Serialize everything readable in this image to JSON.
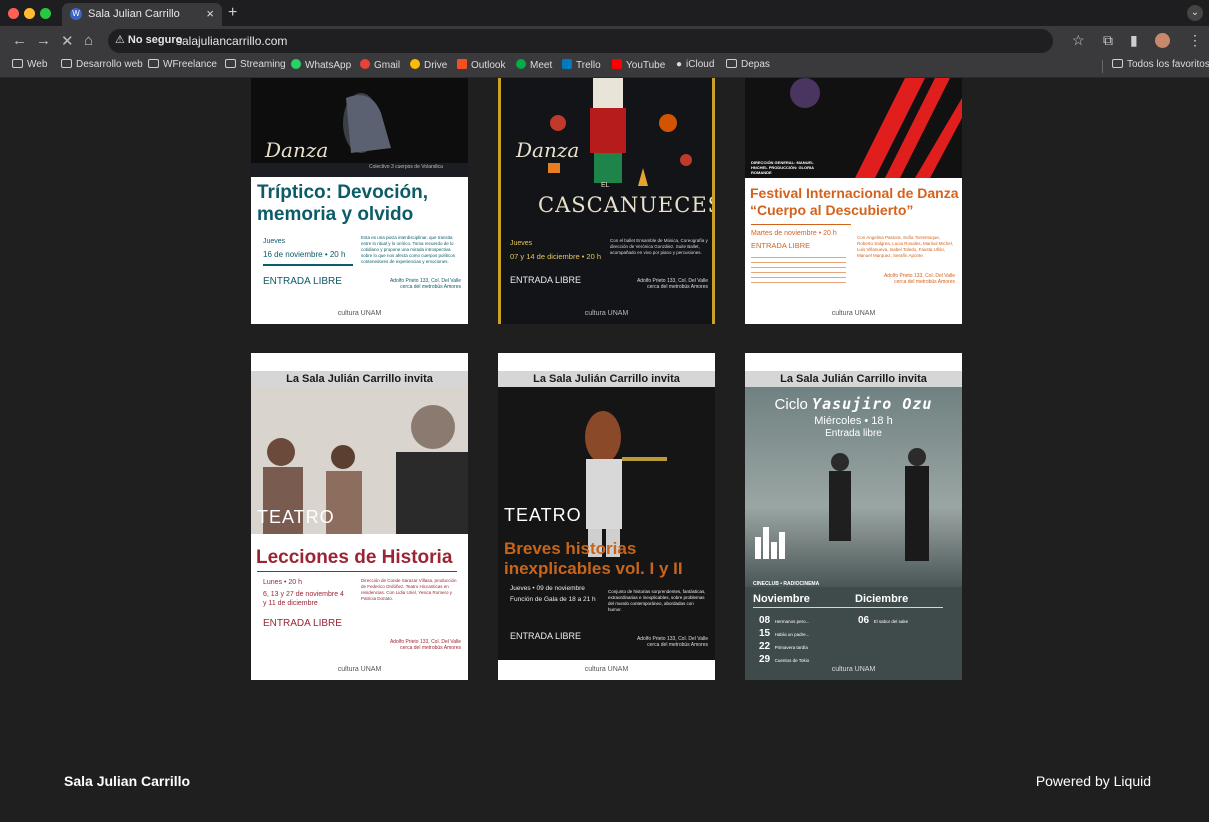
{
  "browser": {
    "tab_title": "Sala Julian Carrillo",
    "favicon_letter": "W",
    "security_label": "No seguro",
    "url": "salajuliancarrillo.com",
    "bookmarks": [
      "Web",
      "Desarrollo web",
      "WFreelance",
      "Streaming",
      "WhatsApp",
      "Gmail",
      "Drive",
      "Outlook",
      "Meet",
      "Trello",
      "YouTube",
      "iCloud",
      "Depas"
    ],
    "all_bookmarks": "Todos los favoritos"
  },
  "posters": [
    {
      "title": "Tríptico: Devoción, memoria y olvido",
      "brand": "Danza",
      "caption": "Colectivo 3 cuerpos de Volandica",
      "when": "Jueves",
      "date": "16 de noviembre • 20 h",
      "entry": "ENTRADA LIBRE",
      "address": "Adolfo Prieto 133, Col. Del Valle cerca del metrobús Amores",
      "blurb": "Esta es una pieza interdisciplinar, que transita entre lo ritual y lo onírico. Toma recuerdo de lo cotidiano y propone una mirada introspectiva sobre lo que nos afecta como cuerpos políticos contenedores de experiencias y emociones."
    },
    {
      "title": "CASCANUECES",
      "prefix": "EL",
      "brand": "Danza",
      "when": "Jueves",
      "date": "07 y 14 de diciembre • 20 h",
      "entry": "ENTRADA LIBRE",
      "address": "Adolfo Prieto 133, Col. Del Valle cerca del metrobús Amores",
      "blurb": "Con el ballet Ensamble de Música, Coreografía y dirección de Verónica González. Suite Ballet, acompañado en vivo por piano y percusiones."
    },
    {
      "title": "Festival Internacional de Danza “Cuerpo al Descubierto”",
      "caption": "DIRECCIÓN GENERAL: MANUEL HNCHEL PRODUCCIÓN: GLORIA ROMANDE",
      "date": "Martes de noviembre • 20 h",
      "entry": "ENTRADA LIBRE",
      "address": "Adolfo Prieto 133, Col. Del Valle cerca del metrobús Amores",
      "blurb": "Con Angelina Pastora, Sofía Torrentoque, Roberto Salgrea, Lucia Rosales, Marisol Michel, Luis Villanueva, Isabel Toledo, Fausta Ullón, Manuel Marquez, Serafín Aponte."
    },
    {
      "invite": "La Sala Julián Carrillo invita",
      "label": "TEATRO",
      "title": "Lecciones de Historia",
      "when": "Lunes • 20 h",
      "date": "6, 13 y 27 de noviembre 4 y 11 de diciembre",
      "entry": "ENTRADA LIBRE",
      "address": "Adolfo Prieto 133, Col. Del Valle cerca del metrobús Amores",
      "blurb": "Dirección de Conde Sarazar Villasa, producción de Federico Ordóñez. Teatro Hiccanticas en residencias. Con Lidia Uriel, Yesica Romero y Patricia Donato."
    },
    {
      "invite": "La Sala Julián Carrillo invita",
      "label": "TEATRO",
      "title": "Breves historias inexplicables vol. I y II",
      "when": "Jueves • 09 de noviembre",
      "date": "Función de Gala de 18 a 21 h",
      "entry": "ENTRADA LIBRE",
      "address": "Adolfo Prieto 133, Col. Del Valle cerca del metrobús Amores",
      "blurb": "Conjunto de historias sorprendentes, fantásticas, extraordinarias e inexplicables, sobre problemas del mundo contemporáneo, abordadas con humor."
    },
    {
      "invite": "La Sala Julián Carrillo invita",
      "cycle": "Ciclo",
      "title": "Yasujiro Ozu",
      "when": "Miércoles • 18 h",
      "entry": "Entrada libre",
      "cineclub": "CINECLUB • RADIOCINEMA",
      "months": [
        "Noviembre",
        "Diciembre"
      ],
      "films_nov": [
        {
          "day": "08",
          "name": "Hermanos pero..."
        },
        {
          "day": "15",
          "name": "Había un padre..."
        },
        {
          "day": "22",
          "name": "Primavera tardía"
        },
        {
          "day": "29",
          "name": "Cuentos de Tokio"
        }
      ],
      "films_dic": [
        {
          "day": "06",
          "name": "El sabor del sake"
        }
      ]
    }
  ],
  "logo_text": "cultura UNAM",
  "footer": {
    "site_name": "Sala Julian Carrillo",
    "powered": "Powered by Liquid"
  }
}
